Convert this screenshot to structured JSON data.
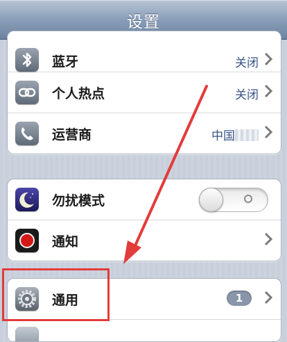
{
  "navbar": {
    "title": "设置"
  },
  "group1": {
    "items": [
      {
        "label": "蓝牙",
        "value": "关闭",
        "icon": "bluetooth-icon"
      },
      {
        "label": "个人热点",
        "value": "关闭",
        "icon": "hotspot-link-icon"
      },
      {
        "label": "运营商",
        "value": "中国",
        "icon": "phone-icon"
      }
    ]
  },
  "group2": {
    "items": [
      {
        "label": "勿扰模式",
        "icon": "moon-icon",
        "toggle": "off"
      },
      {
        "label": "通知",
        "icon": "notification-icon"
      }
    ]
  },
  "group3": {
    "items": [
      {
        "label": "通用",
        "badge": "1",
        "icon": "gear-icon"
      }
    ]
  },
  "colors": {
    "accent_value": "#385487",
    "annotation": "#e33b3b",
    "navbar": "#7d92ae"
  }
}
